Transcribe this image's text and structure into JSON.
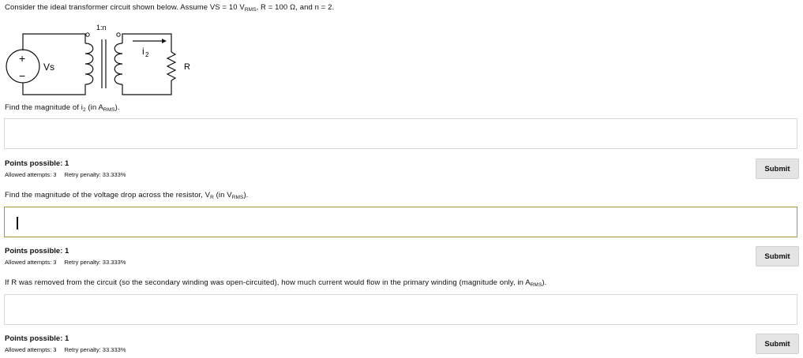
{
  "header": {
    "intro_text": "Consider the ideal transformer circuit shown below. Assume VS = 10 V",
    "intro_sub": "RMS",
    "intro_r": ", R = 100 Ω, and n = 2."
  },
  "circuit": {
    "ratio_label": "1:n",
    "source_plus": "+",
    "source_minus": "−",
    "source_label": "Vs",
    "current_label": "i",
    "current_sub": "2",
    "resistor_label": "R"
  },
  "questions": [
    {
      "prompt_a": "Find the magnitude of i",
      "prompt_sub1": "2",
      "prompt_b": " (in A",
      "prompt_sub2": "RMS",
      "prompt_c": ").",
      "answer_value": "",
      "points": "Points possible: 1",
      "allowed": "Allowed attempts: 3",
      "penalty": "Retry penalty: 33.333%",
      "submit_label": "Submit"
    },
    {
      "prompt_a": "Find the magnitude of the voltage drop across the resistor, V",
      "prompt_sub1": "R",
      "prompt_b": " (in V",
      "prompt_sub2": "RMS",
      "prompt_c": ").",
      "answer_value": "",
      "points": "Points possible: 1",
      "allowed": "Allowed attempts: 3",
      "penalty": "Retry penalty: 33.333%",
      "submit_label": "Submit"
    },
    {
      "prompt_a": "If R was removed from the circuit (so the secondary winding was open-circuited), how much current would flow in the primary winding (magnitude only, in A",
      "prompt_sub1": "RMS",
      "prompt_b": ").",
      "answer_value": "",
      "points": "Points possible: 1",
      "allowed": "Allowed attempts: 3",
      "penalty": "Retry penalty: 33.333%",
      "submit_label": "Submit"
    }
  ]
}
